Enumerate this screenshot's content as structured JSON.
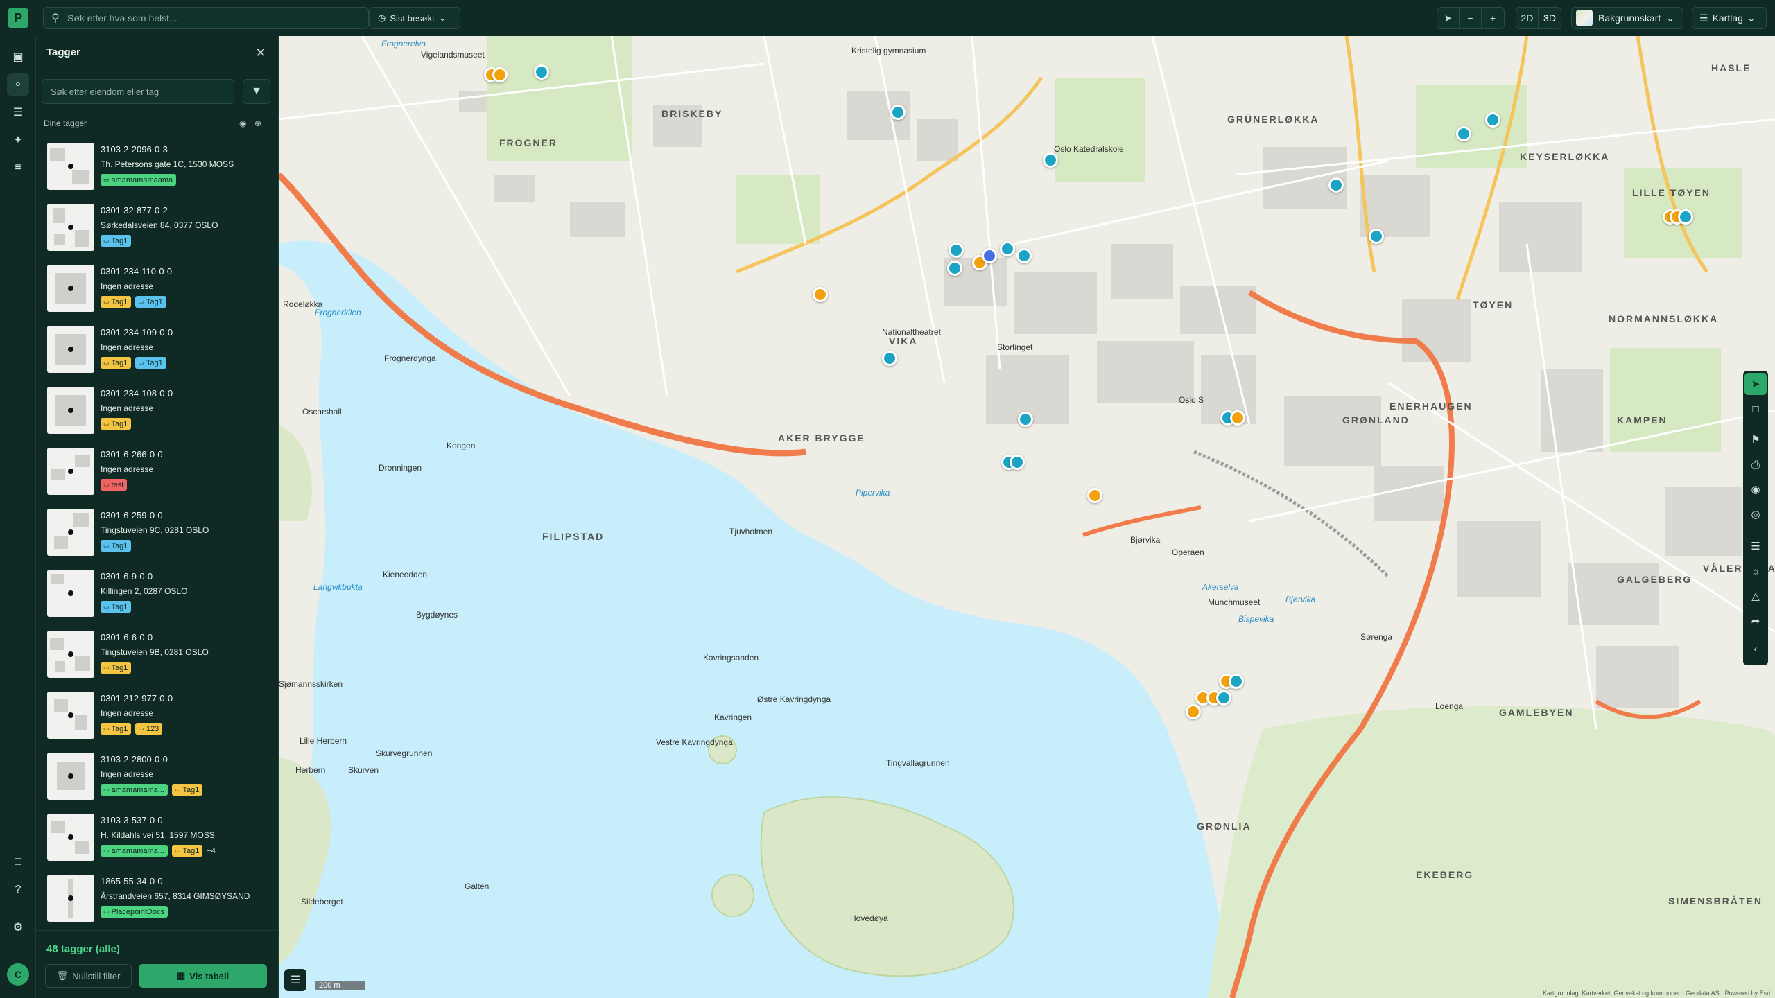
{
  "app": {
    "logo_letter": "P"
  },
  "topbar": {
    "search_placeholder": "Søk etter hva som helst...",
    "recent_label": "Sist besøkt",
    "zoom_out": "−",
    "zoom_in": "+",
    "mode_2d": "2D",
    "mode_3d": "3D",
    "basemap_label": "Bakgrunnskart",
    "layers_label": "Kartlag"
  },
  "panel": {
    "title": "Tagger",
    "search_placeholder": "Søk etter eiendom eller tag",
    "section_label": "Dine tagger",
    "items": [
      {
        "code": "3103-2-2096-0-3",
        "address": "Th. Petersons gate 1C, 1530 MOSS",
        "tags": [
          {
            "label": "amamamamaama",
            "color": "green"
          }
        ],
        "more": ""
      },
      {
        "code": "0301-32-877-0-2",
        "address": "Sørkedalsveien 84, 0377 OSLO",
        "tags": [
          {
            "label": "Tag1",
            "color": "blue"
          }
        ],
        "more": ""
      },
      {
        "code": "0301-234-110-0-0",
        "address": "Ingen adresse",
        "tags": [
          {
            "label": "Tag1",
            "color": "yellow"
          },
          {
            "label": "Tag1",
            "color": "blue"
          }
        ],
        "more": ""
      },
      {
        "code": "0301-234-109-0-0",
        "address": "Ingen adresse",
        "tags": [
          {
            "label": "Tag1",
            "color": "yellow"
          },
          {
            "label": "Tag1",
            "color": "blue"
          }
        ],
        "more": ""
      },
      {
        "code": "0301-234-108-0-0",
        "address": "Ingen adresse",
        "tags": [
          {
            "label": "Tag1",
            "color": "yellow"
          }
        ],
        "more": ""
      },
      {
        "code": "0301-6-266-0-0",
        "address": "Ingen adresse",
        "tags": [
          {
            "label": "test",
            "color": "red"
          }
        ],
        "more": ""
      },
      {
        "code": "0301-6-259-0-0",
        "address": "Tingstuveien 9C, 0281 OSLO",
        "tags": [
          {
            "label": "Tag1",
            "color": "blue"
          }
        ],
        "more": ""
      },
      {
        "code": "0301-6-9-0-0",
        "address": "Killingen 2, 0287 OSLO",
        "tags": [
          {
            "label": "Tag1",
            "color": "blue"
          }
        ],
        "more": ""
      },
      {
        "code": "0301-6-6-0-0",
        "address": "Tingstuveien 9B, 0281 OSLO",
        "tags": [
          {
            "label": "Tag1",
            "color": "yellow"
          }
        ],
        "more": ""
      },
      {
        "code": "0301-212-977-0-0",
        "address": "Ingen adresse",
        "tags": [
          {
            "label": "Tag1",
            "color": "yellow"
          },
          {
            "label": "123",
            "color": "yellow"
          }
        ],
        "more": ""
      },
      {
        "code": "3103-2-2800-0-0",
        "address": "Ingen adresse",
        "tags": [
          {
            "label": "amamamama...",
            "color": "green"
          },
          {
            "label": "Tag1",
            "color": "yellow"
          }
        ],
        "more": ""
      },
      {
        "code": "3103-3-537-0-0",
        "address": "H. Kildahls vei 51, 1597 MOSS",
        "tags": [
          {
            "label": "amamamama...",
            "color": "green"
          },
          {
            "label": "Tag1",
            "color": "yellow"
          }
        ],
        "more": "+4"
      },
      {
        "code": "1865-55-34-0-0",
        "address": "Årstrandveien 657, 8314 GIMSØYSAND",
        "tags": [
          {
            "label": "PlacepointDocs",
            "color": "green"
          }
        ],
        "more": ""
      }
    ],
    "footer": {
      "count_label": "48 tagger (alle)",
      "reset_label": "Nullstill filter",
      "table_label": "Vis tabell"
    }
  },
  "tag_colors": {
    "green": "#4cd37f",
    "blue": "#5bc2ee",
    "yellow": "#f5c542",
    "red": "#f26464"
  },
  "user": {
    "initial": "C"
  },
  "map": {
    "district_labels": [
      "BRISKEBY",
      "FROGNER",
      "GRÜNERLØKKA",
      "KEYSERLØKKA",
      "HASLE",
      "LILLE TØYEN",
      "TØYEN",
      "NORMANNSLØKKA",
      "ENERHAUGEN",
      "GRØNLAND",
      "KAMPEN",
      "AKER BRYGGE",
      "VIKA",
      "FILIPSTAD",
      "VÅLERENGA",
      "GALGEBERG",
      "GAMLEBYEN",
      "GRØNLIA",
      "EKEBERG",
      "SIMENSBRÅTEN"
    ],
    "place_labels": [
      "Vigelandsmuseet",
      "Kristelig gymnasium",
      "Oslo Katedralskole",
      "Nationaltheatret",
      "Stortinget",
      "Oslo S",
      "Kongen",
      "Dronningen",
      "Oscarshall",
      "Kavringsanden",
      "Kavringen",
      "Østre Kavringdynga",
      "Vestre Kavringdynga",
      "Tingvallagrunnen",
      "Hovedøya",
      "Lille Herbern",
      "Herbern",
      "Skurvegrunnen",
      "Skurven",
      "Galten",
      "Sildeberget",
      "Bygdøynes",
      "Kieneodden",
      "Sjømannsskirken",
      "Rodeløkka",
      "Frognerdynga",
      "Operaen",
      "Munchmuseet",
      "Sørenga",
      "Loenga",
      "Tjuvholmen",
      "Bjørvika"
    ],
    "water_labels": [
      "Frognerelva",
      "Frognerkilen",
      "Pipervika",
      "Langvikbukta",
      "Akerselva",
      "Bispevika",
      "Bjørvika"
    ],
    "scale_label": "200 m",
    "attribution": "Kartgrunnlag: Kartverket, Geovekst og kommuner · Geodata AS · Powered by Esri"
  }
}
